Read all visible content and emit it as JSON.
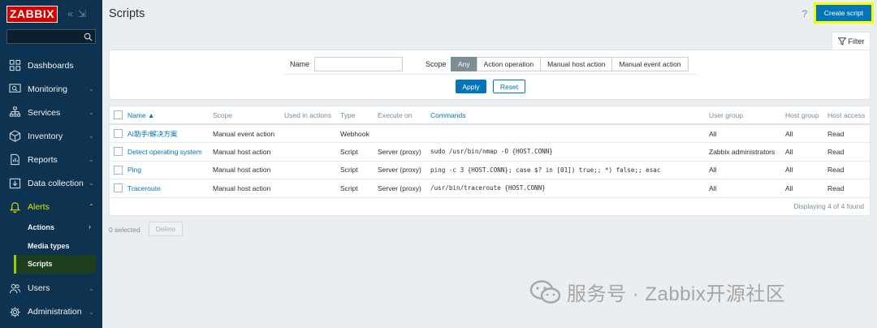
{
  "app": {
    "logo": "ZABBIX"
  },
  "sidebar": {
    "items": [
      {
        "label": "Dashboards",
        "icon": "dashboards-icon",
        "chev": ""
      },
      {
        "label": "Monitoring",
        "icon": "monitoring-icon",
        "chev": "⌄"
      },
      {
        "label": "Services",
        "icon": "services-icon",
        "chev": "⌄"
      },
      {
        "label": "Inventory",
        "icon": "inventory-icon",
        "chev": "⌄"
      },
      {
        "label": "Reports",
        "icon": "reports-icon",
        "chev": "⌄"
      },
      {
        "label": "Data collection",
        "icon": "data-collection-icon",
        "chev": "⌄"
      },
      {
        "label": "Alerts",
        "icon": "bell-icon",
        "chev": "⌃"
      }
    ],
    "alerts_sub": [
      {
        "label": "Actions",
        "chev": "›"
      },
      {
        "label": "Media types",
        "chev": ""
      },
      {
        "label": "Scripts",
        "chev": ""
      }
    ],
    "bottom_items": [
      {
        "label": "Users",
        "icon": "users-icon",
        "chev": "⌄"
      },
      {
        "label": "Administration",
        "icon": "gear-icon",
        "chev": "⌄"
      }
    ]
  },
  "header": {
    "title": "Scripts",
    "help": "?",
    "create_label": "Create script"
  },
  "filter": {
    "tab_label": "Filter",
    "name_label": "Name",
    "name_value": "",
    "scope_label": "Scope",
    "scope_options": [
      "Any",
      "Action operation",
      "Manual host action",
      "Manual event action"
    ],
    "scope_selected": "Any",
    "apply_label": "Apply",
    "reset_label": "Reset"
  },
  "table": {
    "columns": [
      "Name ▲",
      "Scope",
      "Used in actions",
      "Type",
      "Execute on",
      "Commands",
      "User group",
      "Host group",
      "Host access"
    ],
    "rows": [
      {
        "name": "AI助手/解决方案",
        "scope": "Manual event action",
        "used": "",
        "type": "Webhook",
        "execute_on": "",
        "commands": "",
        "user_group": "All",
        "host_group": "All",
        "host_access": "Read"
      },
      {
        "name": "Detect operating system",
        "scope": "Manual host action",
        "used": "",
        "type": "Script",
        "execute_on": "Server (proxy)",
        "commands": "sudo /usr/bin/nmap -O {HOST.CONN}",
        "user_group": "Zabbix administrators",
        "host_group": "All",
        "host_access": "Read"
      },
      {
        "name": "Ping",
        "scope": "Manual host action",
        "used": "",
        "type": "Script",
        "execute_on": "Server (proxy)",
        "commands": "ping -c 3 {HOST.CONN}; case $? in [01]) true;; *) false;; esac",
        "user_group": "All",
        "host_group": "All",
        "host_access": "Read"
      },
      {
        "name": "Traceroute",
        "scope": "Manual host action",
        "used": "",
        "type": "Script",
        "execute_on": "Server (proxy)",
        "commands": "/usr/bin/traceroute {HOST.CONN}",
        "user_group": "All",
        "host_group": "All",
        "host_access": "Read"
      }
    ],
    "footer": "Displaying 4 of 4 found"
  },
  "actions": {
    "selected_count": "0 selected",
    "delete_label": "Delete"
  },
  "watermark": {
    "text": "服务号 · Zabbix开源社区"
  },
  "colors": {
    "sidebar": "#0e3350",
    "accent": "#0275b8",
    "highlight": "#f6ff00",
    "active_nav": "#d6e600"
  }
}
